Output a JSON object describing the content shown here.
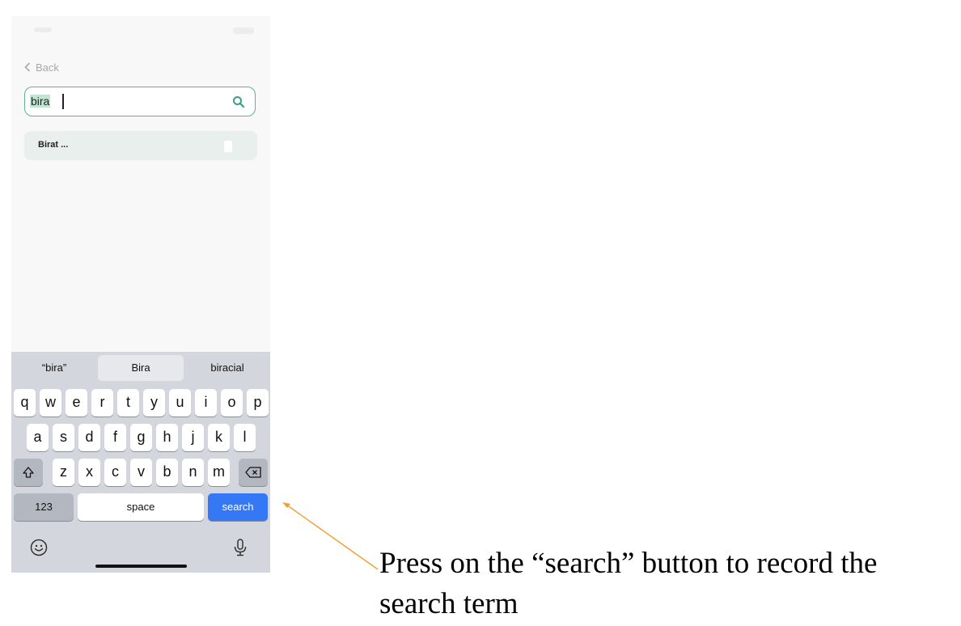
{
  "header": {
    "back_label": "Back"
  },
  "search": {
    "value": "bira"
  },
  "results": [
    {
      "title": "Birat ..."
    }
  ],
  "keyboard": {
    "suggestions": [
      "“bira”",
      "Bira",
      "biracial"
    ],
    "row1": [
      "q",
      "w",
      "e",
      "r",
      "t",
      "y",
      "u",
      "i",
      "o",
      "p"
    ],
    "row2": [
      "a",
      "s",
      "d",
      "f",
      "g",
      "h",
      "j",
      "k",
      "l"
    ],
    "row3": [
      "z",
      "x",
      "c",
      "v",
      "b",
      "n",
      "m"
    ],
    "numbers_label": "123",
    "space_label": "space",
    "search_label": "search"
  },
  "annotation": {
    "text": "Press on the “search” button to record the search term"
  },
  "colors": {
    "accent": "#5fb295",
    "search_key": "#3478f6",
    "arrow": "#f0a030"
  },
  "icons": [
    "back-chevron-icon",
    "search-icon",
    "trash-icon",
    "shift-icon",
    "backspace-icon",
    "emoji-icon",
    "microphone-icon"
  ]
}
